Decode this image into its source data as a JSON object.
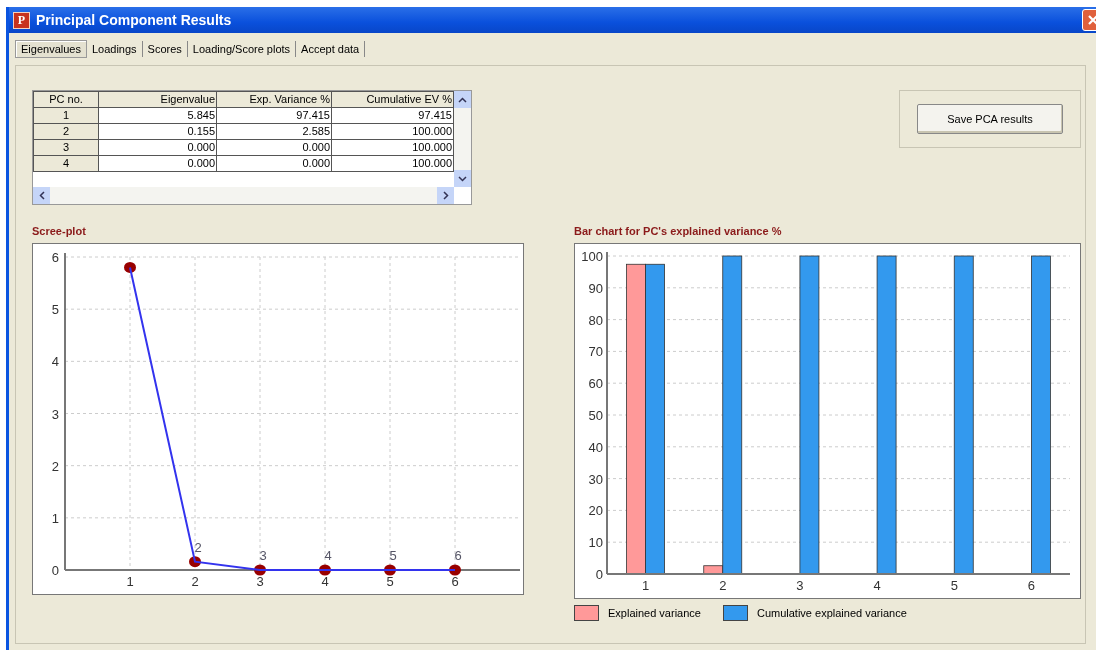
{
  "window": {
    "icon_letter": "P",
    "title": "Principal Component Results"
  },
  "tabs": [
    {
      "label": "Eigenvalues",
      "selected": true
    },
    {
      "label": "Loadings",
      "selected": false
    },
    {
      "label": "Scores",
      "selected": false
    },
    {
      "label": "Loading/Score plots",
      "selected": false
    },
    {
      "label": "Accept data",
      "selected": false
    }
  ],
  "table": {
    "columns": [
      "PC no.",
      "Eigenvalue",
      "Exp. Variance %",
      "Cumulative EV %"
    ],
    "rows": [
      [
        "1",
        "5.845",
        "97.415",
        "97.415"
      ],
      [
        "2",
        "0.155",
        "2.585",
        "100.000"
      ],
      [
        "3",
        "0.000",
        "0.000",
        "100.000"
      ],
      [
        "4",
        "0.000",
        "0.000",
        "100.000"
      ]
    ]
  },
  "save_button": "Save PCA results",
  "scree": {
    "title": "Scree-plot",
    "chart_data": {
      "type": "line",
      "x": [
        1,
        2,
        3,
        4,
        5,
        6
      ],
      "series": [
        {
          "color": "#3333ee",
          "marker": "circle",
          "values": [
            5.8,
            0.16,
            0,
            0,
            0,
            0
          ]
        }
      ],
      "grid": true,
      "xlim": [
        0,
        7
      ],
      "ylim": [
        0,
        6
      ],
      "xticks": [
        1,
        2,
        3,
        4,
        5,
        6
      ],
      "yticks": [
        0,
        1,
        2,
        3,
        4,
        5,
        6
      ],
      "annotations": [
        {
          "x": 2,
          "y": 0.155,
          "text": "2"
        },
        {
          "x": 3,
          "y": 0,
          "text": "3"
        },
        {
          "x": 4,
          "y": 0,
          "text": "4"
        },
        {
          "x": 5,
          "y": 0,
          "text": "5"
        },
        {
          "x": 6,
          "y": 0,
          "text": "6"
        }
      ]
    }
  },
  "bars": {
    "title": "Bar chart for PC's explained variance %",
    "chart_data": {
      "type": "bar",
      "categories": [
        "1",
        "2",
        "3",
        "4",
        "5",
        "6"
      ],
      "series": [
        {
          "name": "Explained variance",
          "color": "#ff9999",
          "values": [
            97.4,
            2.6,
            0,
            0,
            0,
            0
          ]
        },
        {
          "name": "Cumulative explained variance",
          "color": "#3399ee",
          "values": [
            97.4,
            100,
            100,
            100,
            100,
            100
          ]
        }
      ],
      "grid": true,
      "ylim": [
        0,
        100
      ],
      "yticks": [
        0,
        10,
        20,
        30,
        40,
        50,
        60,
        70,
        80,
        90,
        100
      ]
    }
  }
}
